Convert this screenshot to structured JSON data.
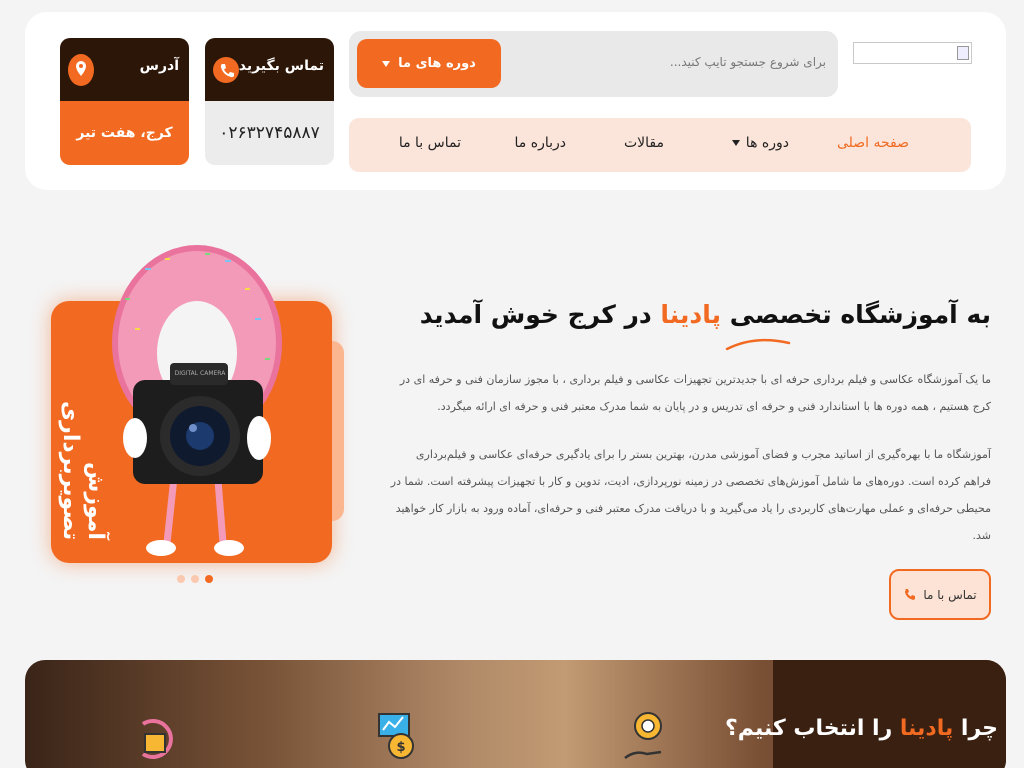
{
  "header": {
    "search_placeholder": "برای شروع جستجو تایپ کنید...",
    "courses_button": "دوره های ما",
    "nav": [
      "صفحه اصلی",
      "دوره ها",
      "مقالات",
      "درباره ما",
      "تماس با ما"
    ],
    "contact": {
      "address_label": "آدرس",
      "address_value": "کرج، هفت تیر",
      "phone_label": "تماس بگیرید",
      "phone_value": "۰۲۶۳۲۷۴۵۸۸۷"
    }
  },
  "hero": {
    "title_before": "به آموزشگاه تخصصی ",
    "title_brand": "پادینا",
    "title_after": " در کرج خوش آمدید",
    "p1": "ما یک آموزشگاه عکاسی و فیلم برداری حرفه ای با جدیدترین تجهیزات عکاسی و فیلم برداری ، با مجوز سازمان فنی و حرفه ای در کرج هستیم ، همه دوره ها با استاندارد فنی و حرفه ای تدریس و در پایان به شما مدرک معتبر فنی و حرفه ای ارائه میگردد.",
    "p2": "آموزشگاه ما با بهره‌گیری از اساتید مجرب و فضای آموزشی مدرن، بهترین بستر را برای یادگیری حرفه‌ای عکاسی و فیلم‌برداری فراهم کرده است. دوره‌های ما شامل آموزش‌های تخصصی در زمینه نورپردازی، ادیت، تدوین و کار با تجهیزات پیشرفته است. شما در محیطی حرفه‌ای و عملی مهارت‌های کاربردی را یاد می‌گیرید و با دریافت مدرک معتبر فنی و حرفه‌ای، آماده ورود به بازار کار خواهید شد.",
    "cta": "تماس با ما"
  },
  "slider": {
    "slide_text": "آموزش تصویربرداری",
    "camera_text": "DIGITAL CAMERA",
    "active_dot": 2
  },
  "why": {
    "title_before": "چرا ",
    "title_brand": "پادینا",
    "title_after": " را انتخاب کنیم؟"
  },
  "colors": {
    "accent": "#f26a21",
    "dark": "#2c1608",
    "nav_bg": "#fbe4da"
  }
}
